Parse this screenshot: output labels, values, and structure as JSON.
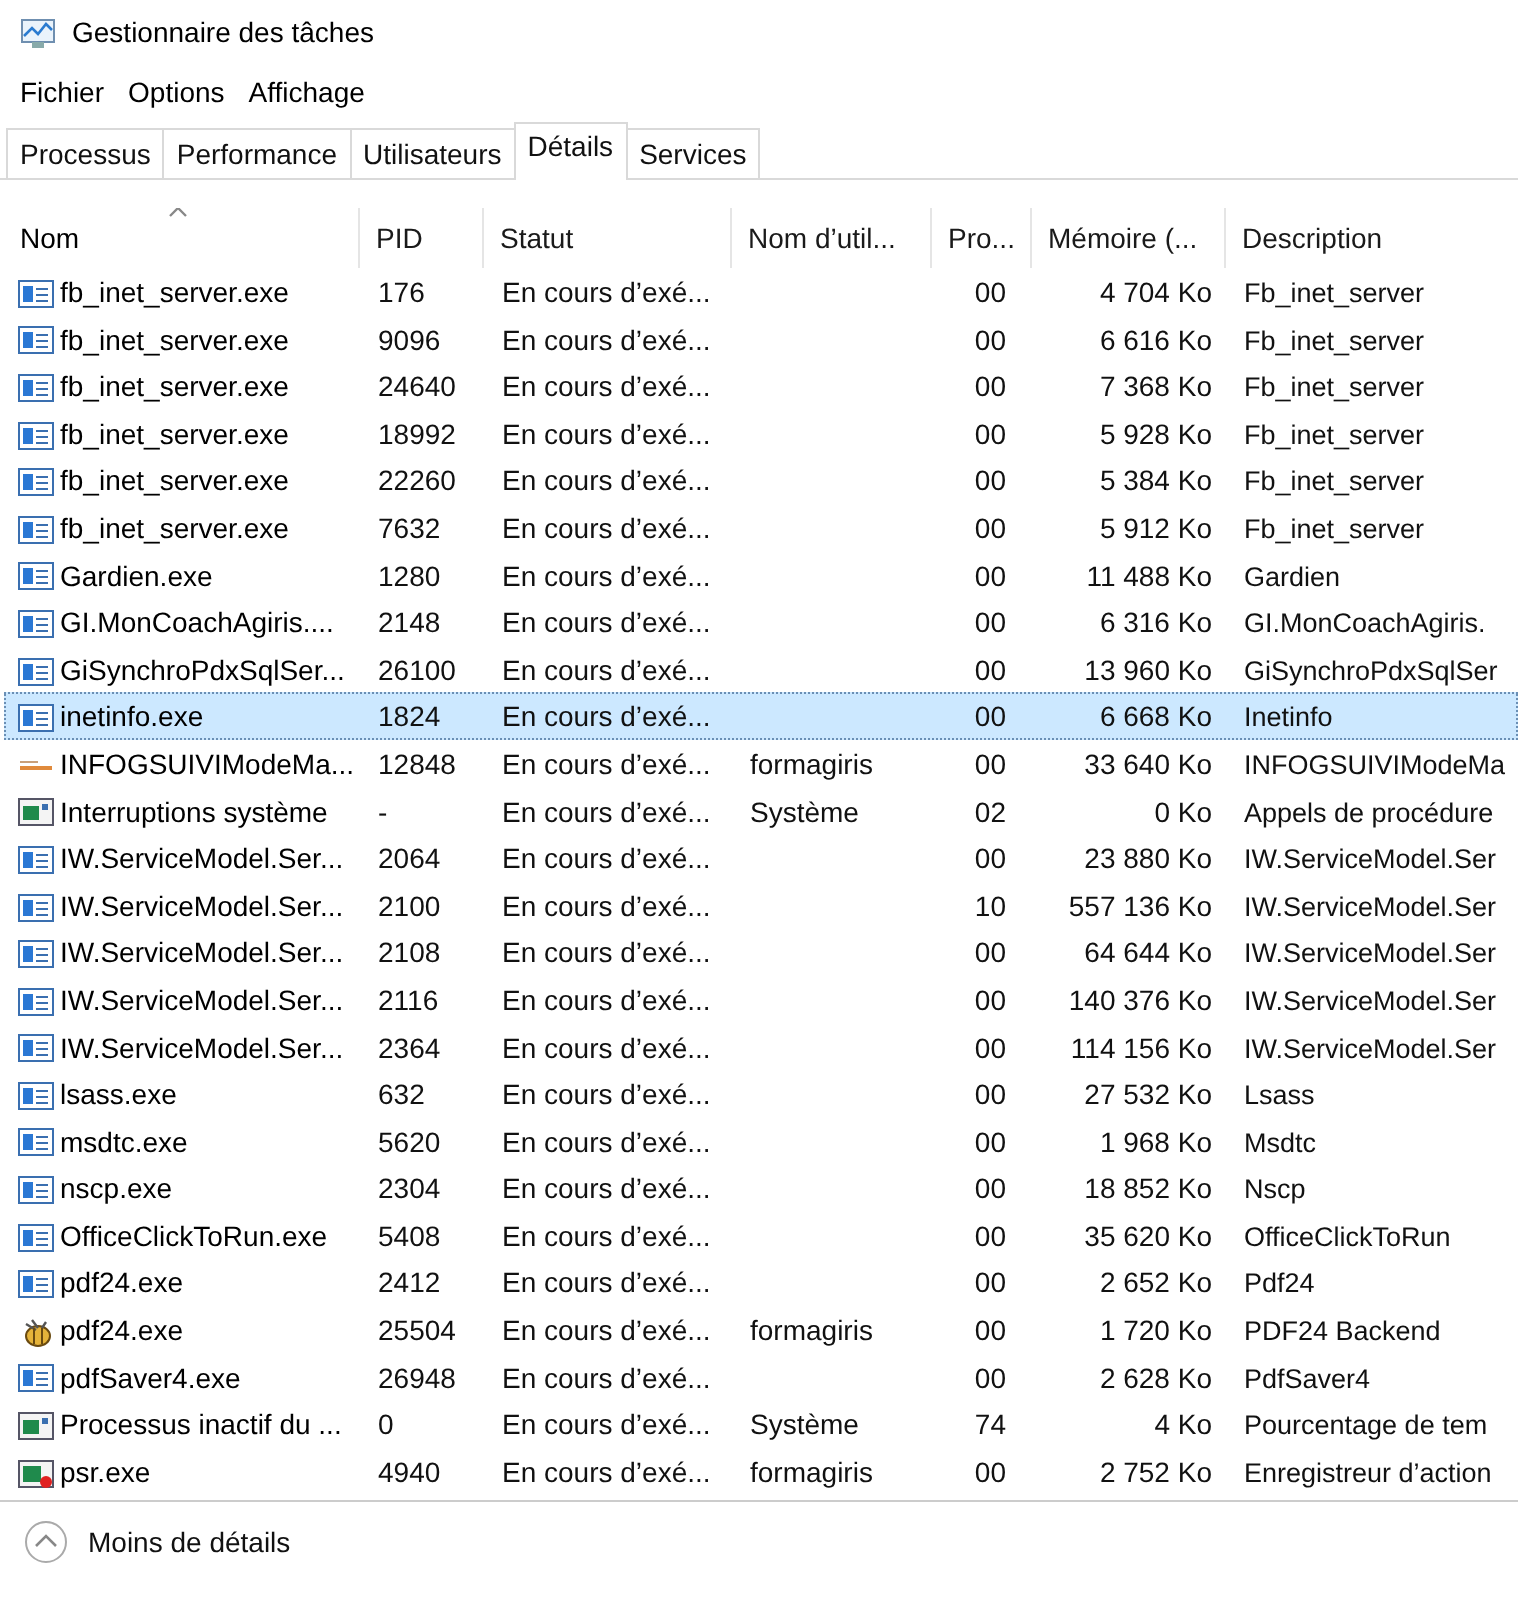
{
  "window": {
    "title": "Gestionnaire des tâches"
  },
  "menu": [
    "Fichier",
    "Options",
    "Affichage"
  ],
  "tabs": [
    {
      "label": "Processus",
      "selected": false
    },
    {
      "label": "Performance",
      "selected": false
    },
    {
      "label": "Utilisateurs",
      "selected": false
    },
    {
      "label": "Détails",
      "selected": true
    },
    {
      "label": "Services",
      "selected": false
    }
  ],
  "table": {
    "columns": [
      {
        "label": "Nom",
        "sorted": true
      },
      {
        "label": "PID",
        "sorted": false
      },
      {
        "label": "Statut",
        "sorted": false
      },
      {
        "label": "Nom d’util...",
        "sorted": false
      },
      {
        "label": "Pro...",
        "sorted": false
      },
      {
        "label": "Mémoire (...",
        "sorted": false
      },
      {
        "label": "Description",
        "sorted": false
      }
    ],
    "rows": [
      {
        "kind": "app",
        "name": "fb_inet_server.exe",
        "pid": "176",
        "status": "En cours d’exé...",
        "user": "",
        "cpu": "00",
        "memory": "4 704 Ko",
        "description": "Fb_inet_server",
        "selected": false
      },
      {
        "kind": "app",
        "name": "fb_inet_server.exe",
        "pid": "9096",
        "status": "En cours d’exé...",
        "user": "",
        "cpu": "00",
        "memory": "6 616 Ko",
        "description": "Fb_inet_server",
        "selected": false
      },
      {
        "kind": "app",
        "name": "fb_inet_server.exe",
        "pid": "24640",
        "status": "En cours d’exé...",
        "user": "",
        "cpu": "00",
        "memory": "7 368 Ko",
        "description": "Fb_inet_server",
        "selected": false
      },
      {
        "kind": "app",
        "name": "fb_inet_server.exe",
        "pid": "18992",
        "status": "En cours d’exé...",
        "user": "",
        "cpu": "00",
        "memory": "5 928 Ko",
        "description": "Fb_inet_server",
        "selected": false
      },
      {
        "kind": "app",
        "name": "fb_inet_server.exe",
        "pid": "22260",
        "status": "En cours d’exé...",
        "user": "",
        "cpu": "00",
        "memory": "5 384 Ko",
        "description": "Fb_inet_server",
        "selected": false
      },
      {
        "kind": "app",
        "name": "fb_inet_server.exe",
        "pid": "7632",
        "status": "En cours d’exé...",
        "user": "",
        "cpu": "00",
        "memory": "5 912 Ko",
        "description": "Fb_inet_server",
        "selected": false
      },
      {
        "kind": "app",
        "name": "Gardien.exe",
        "pid": "1280",
        "status": "En cours d’exé...",
        "user": "",
        "cpu": "00",
        "memory": "11 488 Ko",
        "description": "Gardien",
        "selected": false
      },
      {
        "kind": "app",
        "name": "GI.MonCoachAgiris....",
        "pid": "2148",
        "status": "En cours d’exé...",
        "user": "",
        "cpu": "00",
        "memory": "6 316 Ko",
        "description": "GI.MonCoachAgiris.",
        "selected": false
      },
      {
        "kind": "app",
        "name": "GiSynchroPdxSqlSer...",
        "pid": "26100",
        "status": "En cours d’exé...",
        "user": "",
        "cpu": "00",
        "memory": "13 960 Ko",
        "description": "GiSynchroPdxSqlSer",
        "selected": false
      },
      {
        "kind": "app",
        "name": "inetinfo.exe",
        "pid": "1824",
        "status": "En cours d’exé...",
        "user": "",
        "cpu": "00",
        "memory": "6 668 Ko",
        "description": "Inetinfo",
        "selected": true
      },
      {
        "kind": "tool",
        "name": "INFOGSUIVIModeMa...",
        "pid": "12848",
        "status": "En cours d’exé...",
        "user": "formagiris",
        "cpu": "00",
        "memory": "33 640 Ko",
        "description": "INFOGSUIVIModeMa",
        "selected": false
      },
      {
        "kind": "system",
        "name": "Interruptions système",
        "pid": "-",
        "status": "En cours d’exé...",
        "user": "Système",
        "cpu": "02",
        "memory": "0 Ko",
        "description": "Appels de procédure",
        "selected": false
      },
      {
        "kind": "app",
        "name": "IW.ServiceModel.Ser...",
        "pid": "2064",
        "status": "En cours d’exé...",
        "user": "",
        "cpu": "00",
        "memory": "23 880 Ko",
        "description": "IW.ServiceModel.Ser",
        "selected": false
      },
      {
        "kind": "app",
        "name": "IW.ServiceModel.Ser...",
        "pid": "2100",
        "status": "En cours d’exé...",
        "user": "",
        "cpu": "10",
        "memory": "557 136 Ko",
        "description": "IW.ServiceModel.Ser",
        "selected": false
      },
      {
        "kind": "app",
        "name": "IW.ServiceModel.Ser...",
        "pid": "2108",
        "status": "En cours d’exé...",
        "user": "",
        "cpu": "00",
        "memory": "64 644 Ko",
        "description": "IW.ServiceModel.Ser",
        "selected": false
      },
      {
        "kind": "app",
        "name": "IW.ServiceModel.Ser...",
        "pid": "2116",
        "status": "En cours d’exé...",
        "user": "",
        "cpu": "00",
        "memory": "140 376 Ko",
        "description": "IW.ServiceModel.Ser",
        "selected": false
      },
      {
        "kind": "app",
        "name": "IW.ServiceModel.Ser...",
        "pid": "2364",
        "status": "En cours d’exé...",
        "user": "",
        "cpu": "00",
        "memory": "114 156 Ko",
        "description": "IW.ServiceModel.Ser",
        "selected": false
      },
      {
        "kind": "app",
        "name": "lsass.exe",
        "pid": "632",
        "status": "En cours d’exé...",
        "user": "",
        "cpu": "00",
        "memory": "27 532 Ko",
        "description": "Lsass",
        "selected": false
      },
      {
        "kind": "app",
        "name": "msdtc.exe",
        "pid": "5620",
        "status": "En cours d’exé...",
        "user": "",
        "cpu": "00",
        "memory": "1 968 Ko",
        "description": "Msdtc",
        "selected": false
      },
      {
        "kind": "app",
        "name": "nscp.exe",
        "pid": "2304",
        "status": "En cours d’exé...",
        "user": "",
        "cpu": "00",
        "memory": "18 852 Ko",
        "description": "Nscp",
        "selected": false
      },
      {
        "kind": "app",
        "name": "OfficeClickToRun.exe",
        "pid": "5408",
        "status": "En cours d’exé...",
        "user": "",
        "cpu": "00",
        "memory": "35 620 Ko",
        "description": "OfficeClickToRun",
        "selected": false
      },
      {
        "kind": "app",
        "name": "pdf24.exe",
        "pid": "2412",
        "status": "En cours d’exé...",
        "user": "",
        "cpu": "00",
        "memory": "2 652 Ko",
        "description": "Pdf24",
        "selected": false
      },
      {
        "kind": "bee",
        "name": "pdf24.exe",
        "pid": "25504",
        "status": "En cours d’exé...",
        "user": "formagiris",
        "cpu": "00",
        "memory": "1 720 Ko",
        "description": "PDF24 Backend",
        "selected": false
      },
      {
        "kind": "app",
        "name": "pdfSaver4.exe",
        "pid": "26948",
        "status": "En cours d’exé...",
        "user": "",
        "cpu": "00",
        "memory": "2 628 Ko",
        "description": "PdfSaver4",
        "selected": false
      },
      {
        "kind": "system",
        "name": "Processus inactif du ...",
        "pid": "0",
        "status": "En cours d’exé...",
        "user": "Système",
        "cpu": "74",
        "memory": "4 Ko",
        "description": "Pourcentage de tem",
        "selected": false
      },
      {
        "kind": "recorder",
        "name": "psr.exe",
        "pid": "4940",
        "status": "En cours d’exé...",
        "user": "formagiris",
        "cpu": "00",
        "memory": "2 752 Ko",
        "description": "Enregistreur d’action",
        "selected": false
      }
    ]
  },
  "footer": {
    "label": "Moins de détails"
  }
}
